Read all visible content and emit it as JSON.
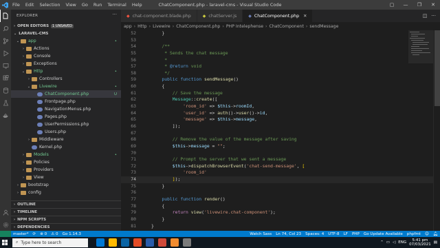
{
  "titlebar": {
    "menu": [
      "File",
      "Edit",
      "Selection",
      "View",
      "Go",
      "Run",
      "Terminal",
      "Help"
    ],
    "title": "ChatComponent.php - laravel-cms - Visual Studio Code"
  },
  "sidebar": {
    "explorer_label": "EXPLORER",
    "open_editors": "OPEN EDITORS",
    "unsaved_badge": "1 UNSAVED",
    "project": "LARAVEL-CMS",
    "tree": [
      {
        "label": "app",
        "depth": 0,
        "type": "folder",
        "open": true,
        "mark": "•",
        "markColor": "#73c991",
        "labelColor": "#73c991"
      },
      {
        "label": "Actions",
        "depth": 1,
        "type": "folder",
        "open": false,
        "mark": "",
        "labelColor": "#ccc"
      },
      {
        "label": "Console",
        "depth": 1,
        "type": "folder",
        "open": false,
        "mark": "",
        "labelColor": "#ccc"
      },
      {
        "label": "Exceptions",
        "depth": 1,
        "type": "folder",
        "open": false,
        "mark": "",
        "labelColor": "#ccc"
      },
      {
        "label": "Http",
        "depth": 1,
        "type": "folder",
        "open": true,
        "mark": "•",
        "markColor": "#73c991",
        "labelColor": "#73c991"
      },
      {
        "label": "Controllers",
        "depth": 2,
        "type": "folder",
        "open": false,
        "mark": "",
        "labelColor": "#ccc"
      },
      {
        "label": "Livewire",
        "depth": 2,
        "type": "folder",
        "open": true,
        "mark": "•",
        "markColor": "#73c991",
        "labelColor": "#73c991"
      },
      {
        "label": "ChatComponent.php",
        "depth": 3,
        "type": "php",
        "mark": "U",
        "markColor": "#73c991",
        "labelColor": "#73c991",
        "selected": true
      },
      {
        "label": "Frontpage.php",
        "depth": 3,
        "type": "php",
        "mark": "",
        "labelColor": "#ccc"
      },
      {
        "label": "NavigationMenus.php",
        "depth": 3,
        "type": "php",
        "mark": "",
        "labelColor": "#ccc"
      },
      {
        "label": "Pages.php",
        "depth": 3,
        "type": "php",
        "mark": "",
        "labelColor": "#ccc"
      },
      {
        "label": "UserPermissions.php",
        "depth": 3,
        "type": "php",
        "mark": "",
        "labelColor": "#ccc"
      },
      {
        "label": "Users.php",
        "depth": 3,
        "type": "php",
        "mark": "",
        "labelColor": "#ccc"
      },
      {
        "label": "Middleware",
        "depth": 2,
        "type": "folder",
        "open": false,
        "mark": "",
        "labelColor": "#ccc"
      },
      {
        "label": "Kernel.php",
        "depth": 2,
        "type": "php",
        "mark": "",
        "labelColor": "#ccc"
      },
      {
        "label": "Models",
        "depth": 1,
        "type": "folder",
        "open": false,
        "mark": "•",
        "markColor": "#73c991",
        "labelColor": "#73c991"
      },
      {
        "label": "Policies",
        "depth": 1,
        "type": "folder",
        "open": false,
        "mark": "",
        "labelColor": "#ccc"
      },
      {
        "label": "Providers",
        "depth": 1,
        "type": "folder",
        "open": false,
        "mark": "",
        "labelColor": "#ccc"
      },
      {
        "label": "View",
        "depth": 1,
        "type": "folder",
        "open": false,
        "mark": "",
        "labelColor": "#ccc"
      },
      {
        "label": "bootstrap",
        "depth": 0,
        "type": "folder",
        "open": false,
        "mark": "",
        "labelColor": "#ccc"
      },
      {
        "label": "config",
        "depth": 0,
        "type": "folder",
        "open": false,
        "mark": "",
        "labelColor": "#ccc"
      }
    ],
    "bottom_sections": [
      "OUTLINE",
      "TIMELINE",
      "NPM SCRIPTS",
      "DEPENDENCIES"
    ]
  },
  "tabs": [
    {
      "label": "chat-component.blade.php",
      "icon": "blade-icon",
      "active": false,
      "iconColor": "#f05340"
    },
    {
      "label": "chatServer.js",
      "icon": "js-icon",
      "active": false,
      "iconColor": "#cbcb41"
    },
    {
      "label": "ChatComponent.php",
      "icon": "php-icon",
      "active": true,
      "iconColor": "#6c7fb7"
    }
  ],
  "breadcrumbs": [
    "app",
    "Http",
    "Livewire",
    "ChatComponent.php",
    "PHP Intelephense",
    "ChatComponent",
    "sendMessage"
  ],
  "editor": {
    "current_line": 74,
    "lines": [
      {
        "n": "52",
        "tokens": [
          [
            "    }",
            "c-pun"
          ]
        ]
      },
      {
        "n": "53",
        "tokens": [
          [
            "",
            "c-pun"
          ]
        ]
      },
      {
        "n": "54",
        "tokens": [
          [
            "    /**",
            "c-cm"
          ]
        ]
      },
      {
        "n": "55",
        "tokens": [
          [
            "     * Sends the chat message",
            "c-cm"
          ]
        ]
      },
      {
        "n": "56",
        "tokens": [
          [
            "     *",
            "c-cm"
          ]
        ]
      },
      {
        "n": "57",
        "tokens": [
          [
            "     * ",
            "c-cm"
          ],
          [
            "@return",
            "c-kw"
          ],
          [
            " void",
            "c-cm"
          ]
        ]
      },
      {
        "n": "58",
        "tokens": [
          [
            "     */",
            "c-cm"
          ]
        ]
      },
      {
        "n": "59",
        "tokens": [
          [
            "    ",
            "c-pun"
          ],
          [
            "public",
            "c-kw"
          ],
          [
            " ",
            "c-pun"
          ],
          [
            "function",
            "c-kw"
          ],
          [
            " ",
            "c-pun"
          ],
          [
            "sendMessage",
            "c-fn"
          ],
          [
            "()",
            "c-pun"
          ]
        ]
      },
      {
        "n": "60",
        "tokens": [
          [
            "    {",
            "c-pun"
          ]
        ]
      },
      {
        "n": "61",
        "tokens": [
          [
            "        // Save the message",
            "c-cm"
          ]
        ]
      },
      {
        "n": "62",
        "tokens": [
          [
            "        ",
            "c-pun"
          ],
          [
            "Message",
            "c-cls"
          ],
          [
            "::",
            "c-pun"
          ],
          [
            "create",
            "c-fn"
          ],
          [
            "([",
            "c-pun"
          ]
        ]
      },
      {
        "n": "63",
        "tokens": [
          [
            "            ",
            "c-pun"
          ],
          [
            "'room_id'",
            "c-st"
          ],
          [
            " => ",
            "c-pun"
          ],
          [
            "$this",
            "c-var"
          ],
          [
            "->",
            "c-pun"
          ],
          [
            "roomId",
            "c-var"
          ],
          [
            ",",
            "c-pun"
          ]
        ]
      },
      {
        "n": "64",
        "tokens": [
          [
            "            ",
            "c-pun"
          ],
          [
            "'user_id'",
            "c-st"
          ],
          [
            " => ",
            "c-pun"
          ],
          [
            "auth",
            "c-fn"
          ],
          [
            "()->",
            "c-pun"
          ],
          [
            "user",
            "c-fn"
          ],
          [
            "()->",
            "c-pun"
          ],
          [
            "id",
            "c-var"
          ],
          [
            ",",
            "c-pun"
          ]
        ]
      },
      {
        "n": "65",
        "tokens": [
          [
            "            ",
            "c-pun"
          ],
          [
            "'message'",
            "c-st"
          ],
          [
            " => ",
            "c-pun"
          ],
          [
            "$this",
            "c-var"
          ],
          [
            "->",
            "c-pun"
          ],
          [
            "message",
            "c-var"
          ],
          [
            ",",
            "c-pun"
          ]
        ]
      },
      {
        "n": "66",
        "tokens": [
          [
            "        ]);",
            "c-pun"
          ]
        ]
      },
      {
        "n": "67",
        "tokens": [
          [
            "",
            "c-pun"
          ]
        ]
      },
      {
        "n": "68",
        "tokens": [
          [
            "        // Remove the value of the message after saving",
            "c-cm"
          ]
        ]
      },
      {
        "n": "69",
        "tokens": [
          [
            "        ",
            "c-pun"
          ],
          [
            "$this",
            "c-var"
          ],
          [
            "->",
            "c-pun"
          ],
          [
            "message",
            "c-var"
          ],
          [
            " = ",
            "c-pun"
          ],
          [
            "\"\"",
            "c-st"
          ],
          [
            ";",
            "c-pun"
          ]
        ]
      },
      {
        "n": "70",
        "tokens": [
          [
            "",
            "c-pun"
          ]
        ]
      },
      {
        "n": "71",
        "tokens": [
          [
            "        // Prompt the server that we sent a message",
            "c-cm"
          ]
        ]
      },
      {
        "n": "72",
        "tokens": [
          [
            "        ",
            "c-pun"
          ],
          [
            "$this",
            "c-var"
          ],
          [
            "->",
            "c-pun"
          ],
          [
            "dispatchBrowserEvent",
            "c-fn"
          ],
          [
            "(",
            "c-pun"
          ],
          [
            "'chat-send-message'",
            "c-st"
          ],
          [
            ", ",
            "c-pun"
          ],
          [
            "[",
            "c-br"
          ]
        ]
      },
      {
        "n": "73",
        "tokens": [
          [
            "            ",
            "c-pun"
          ],
          [
            "'room_id'",
            "c-st"
          ]
        ]
      },
      {
        "n": "74",
        "tokens": [
          [
            "        ",
            "c-pun"
          ],
          [
            "]",
            "c-br"
          ],
          [
            ");",
            "c-pun"
          ]
        ]
      },
      {
        "n": "75",
        "tokens": [
          [
            "    }",
            "c-pun"
          ]
        ]
      },
      {
        "n": "76",
        "tokens": [
          [
            "",
            "c-pun"
          ]
        ]
      },
      {
        "n": "77",
        "tokens": [
          [
            "    ",
            "c-pun"
          ],
          [
            "public",
            "c-kw"
          ],
          [
            " ",
            "c-pun"
          ],
          [
            "function",
            "c-kw"
          ],
          [
            " ",
            "c-pun"
          ],
          [
            "render",
            "c-fn"
          ],
          [
            "()",
            "c-pun"
          ]
        ]
      },
      {
        "n": "78",
        "tokens": [
          [
            "    {",
            "c-pun"
          ]
        ]
      },
      {
        "n": "79",
        "tokens": [
          [
            "        ",
            "c-pun"
          ],
          [
            "return",
            "c-ctl"
          ],
          [
            " ",
            "c-pun"
          ],
          [
            "view",
            "c-fn"
          ],
          [
            "(",
            "c-pun"
          ],
          [
            "'livewire.chat-component'",
            "c-st"
          ],
          [
            ");",
            "c-pun"
          ]
        ]
      },
      {
        "n": "80",
        "tokens": [
          [
            "    }",
            "c-pun"
          ]
        ]
      },
      {
        "n": "81",
        "tokens": [
          [
            "}",
            "c-pun"
          ]
        ]
      }
    ]
  },
  "statusbar": {
    "branch": "master*",
    "sync": "⟳",
    "errors": "⊗ 0",
    "warnings": "⚠ 0",
    "go": "Go 1.14.3",
    "watch_sass": "Watch Sass",
    "position": "Ln 74, Col 23",
    "spaces": "Spaces: 4",
    "encoding": "UTF-8",
    "eol": "LF",
    "language": "PHP",
    "go_update": "Go Update Available",
    "formatter": "phpfmt"
  },
  "taskbar": {
    "search_placeholder": "Type here to search",
    "app_colors": [
      "#0078d4",
      "#ffb900",
      "#0a64a4",
      "#e34c26",
      "#2a5caa",
      "#d04a3a",
      "#f18c30",
      "#7b7b7b"
    ],
    "lang": "ENG",
    "time": "5:41 pm",
    "date": "07/03/2021"
  }
}
